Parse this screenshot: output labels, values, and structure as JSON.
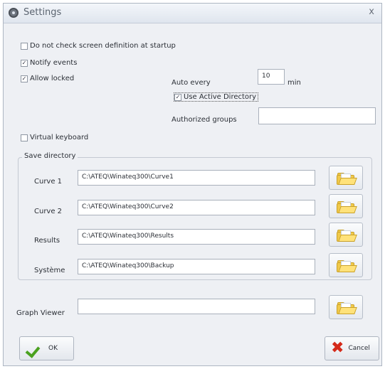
{
  "window": {
    "title": "Settings",
    "close_label": "x"
  },
  "options": {
    "no_check_screen": {
      "label": "Do not check screen definition at startup",
      "checked": false
    },
    "notify_events": {
      "label": "Notify events",
      "checked": true
    },
    "allow_locked": {
      "label": "Allow locked",
      "checked": true
    },
    "virtual_keyboard": {
      "label": "Virtual keyboard",
      "checked": false
    }
  },
  "auto": {
    "label": "Auto every",
    "value": "10",
    "unit": "min"
  },
  "active_directory": {
    "label": "Use Active Directory",
    "checked": true
  },
  "authorized_groups": {
    "label": "Authorized groups",
    "value": ""
  },
  "save_directory": {
    "title": "Save directory",
    "rows": [
      {
        "label": "Curve 1",
        "path": "C:\\ATEQ\\Winateq300\\Curve1"
      },
      {
        "label": "Curve 2",
        "path": "C:\\ATEQ\\Winateq300\\Curve2"
      },
      {
        "label": "Results",
        "path": "C:\\ATEQ\\Winateq300\\Results"
      },
      {
        "label": "Système",
        "path": "C:\\ATEQ\\Winateq300\\Backup"
      }
    ]
  },
  "graph_viewer": {
    "label": "Graph Viewer",
    "value": ""
  },
  "buttons": {
    "ok": "OK",
    "cancel": "Cancel"
  },
  "icons": {
    "title": "gear-icon",
    "browse": "folder-icon",
    "ok": "checkmark-icon",
    "cancel": "x-icon"
  },
  "colors": {
    "folder": "#f0c94a",
    "ok_check": "#4aa11f",
    "cancel_x": "#d42a1a"
  }
}
